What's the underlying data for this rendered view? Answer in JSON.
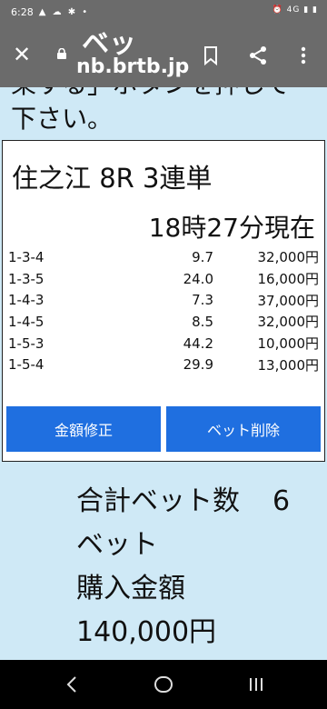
{
  "status_bar": {
    "time": "6:28",
    "left_icons": "▲ ☁ ✱ •",
    "right_icons": "⏰ 4G ▮ ▮"
  },
  "app_bar": {
    "title": "ベッ",
    "url": "nb.brtb.jp",
    "close_icon": "close-icon",
    "lock_icon": "lock-icon",
    "bookmark_icon": "bookmark-icon",
    "share_icon": "share-icon",
    "more_icon": "more-vertical-icon"
  },
  "instruction": {
    "line1": "果する」ボタンを押して",
    "line2": "下さい。"
  },
  "card": {
    "race": "住之江 8R 3連単",
    "as_of": "18時27分現在",
    "rows": [
      {
        "combo": "1-3-4",
        "odds": "9.7",
        "amount": "32,000円"
      },
      {
        "combo": "1-3-5",
        "odds": "24.0",
        "amount": "16,000円"
      },
      {
        "combo": "1-4-3",
        "odds": "7.3",
        "amount": "37,000円"
      },
      {
        "combo": "1-4-5",
        "odds": "8.5",
        "amount": "32,000円"
      },
      {
        "combo": "1-5-3",
        "odds": "44.2",
        "amount": "10,000円"
      },
      {
        "combo": "1-5-4",
        "odds": "29.9",
        "amount": "13,000円"
      }
    ],
    "edit_button": "金額修正",
    "delete_button": "ベット削除"
  },
  "summary": {
    "count_label": "合計ベット数",
    "count_value": "6",
    "count_unit": "ベット",
    "amount_label": "購入金額",
    "amount_value": "140,000円"
  },
  "colors": {
    "button": "#1f6fe0",
    "page_bg": "#cfe9f6",
    "toolbar": "#6b6b6b"
  }
}
